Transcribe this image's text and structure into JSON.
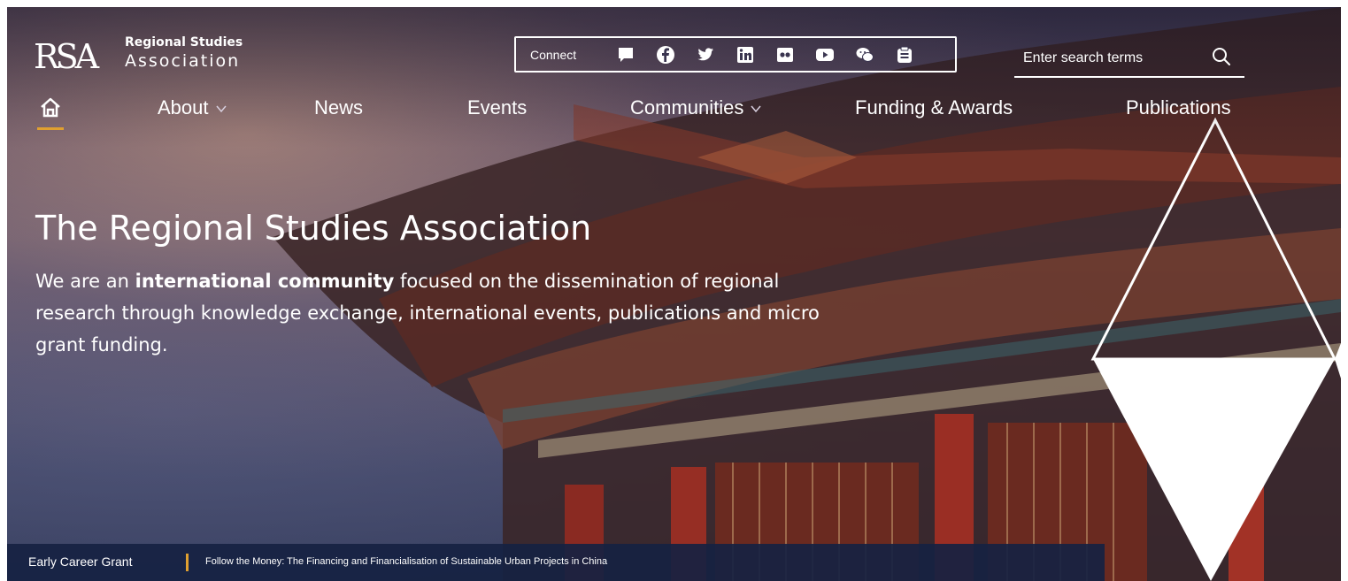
{
  "logo": {
    "mark": "RSA",
    "line1": "Regional Studies",
    "line2": "Association"
  },
  "connect": {
    "label": "Connect",
    "icons": [
      "chat-icon",
      "facebook-icon",
      "twitter-icon",
      "linkedin-icon",
      "flickr-icon",
      "youtube-icon",
      "wechat-icon",
      "clipboard-icon"
    ]
  },
  "search": {
    "placeholder": "Enter search terms"
  },
  "nav": {
    "about": "About",
    "news": "News",
    "events": "Events",
    "communities": "Communities",
    "funding": "Funding & Awards",
    "publications": "Publications"
  },
  "hero": {
    "title": "The Regional Studies Association",
    "desc_pre": "We are an",
    "desc_bold": "international community",
    "desc_post": "focused on the dissemination of regional research through knowledge exchange, international events, publications and micro grant funding."
  },
  "ticker": {
    "label": "Early Career Grant",
    "link": "Follow the Money: The Financing and Financialisation of Sustainable Urban Projects in China"
  },
  "colors": {
    "accent": "#e0a030",
    "ticker_bg": "#162242",
    "text": "#ffffff"
  }
}
